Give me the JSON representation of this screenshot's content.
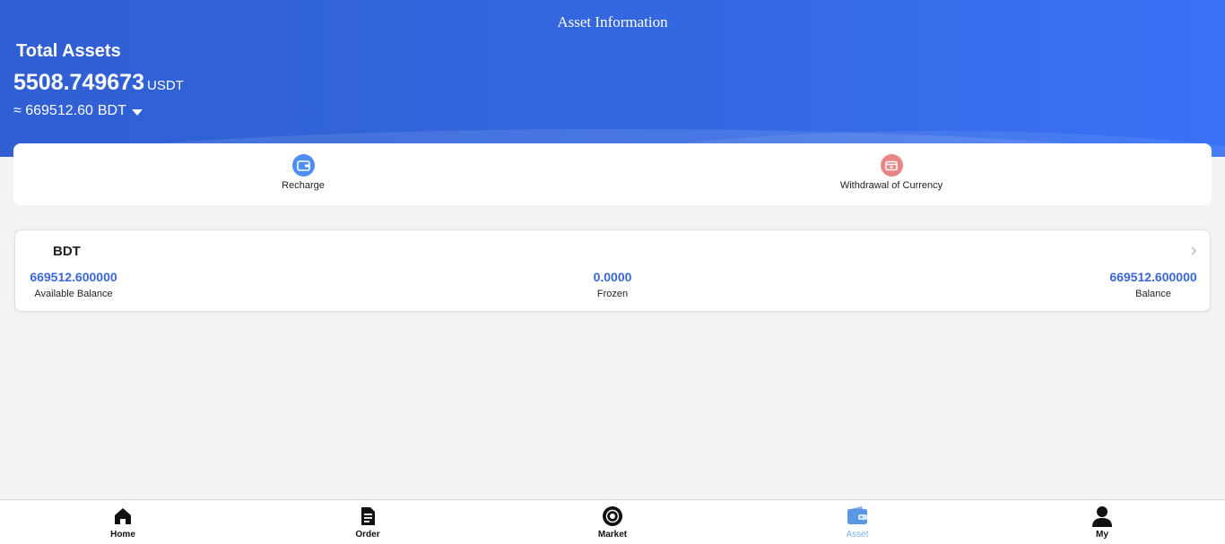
{
  "header": {
    "title": "Asset Information",
    "total_label": "Total Assets",
    "total_value": "5508.749673",
    "total_unit": "USDT",
    "approx_value": "≈ 669512.60",
    "approx_currency": "BDT",
    "gradient_start": "#2f5fd2",
    "gradient_end": "#3a72f6"
  },
  "actions": [
    {
      "label": "Recharge",
      "icon": "wallet-icon",
      "color": "#4f8df5"
    },
    {
      "label": "Withdrawal of Currency",
      "icon": "withdraw-card-icon",
      "color": "#ea8585"
    }
  ],
  "currency_card": {
    "title": "BDT",
    "available_value": "669512.600000",
    "available_label": "Available Balance",
    "frozen_value": "0.0000",
    "frozen_label": "Frozen",
    "balance_value": "669512.600000",
    "balance_label": "Balance",
    "value_color": "#3a66d8"
  },
  "tabbar": {
    "items": [
      {
        "label": "Home",
        "icon": "home-icon"
      },
      {
        "label": "Order",
        "icon": "document-icon"
      },
      {
        "label": "Market",
        "icon": "market-icon"
      },
      {
        "label": "Asset",
        "icon": "wallet-icon",
        "active": true
      },
      {
        "label": "My",
        "icon": "user-icon"
      }
    ],
    "active_color": "#7fb0ee"
  }
}
